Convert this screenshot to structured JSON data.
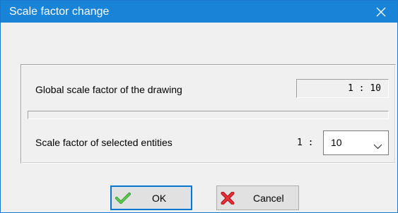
{
  "window": {
    "title": "Scale factor change",
    "close_icon": "close-icon",
    "titlebar_color": "#1883d7"
  },
  "global_scale": {
    "label": "Global scale factor of the drawing",
    "value": "1 : 10"
  },
  "selected_scale": {
    "label": "Scale factor of selected entities",
    "prefix": "1 :",
    "value": "10",
    "dropdown_icon": "chevron-down-icon"
  },
  "buttons": {
    "ok_label": "OK",
    "ok_icon": "checkmark-icon",
    "cancel_label": "Cancel",
    "cancel_icon": "red-x-icon"
  }
}
